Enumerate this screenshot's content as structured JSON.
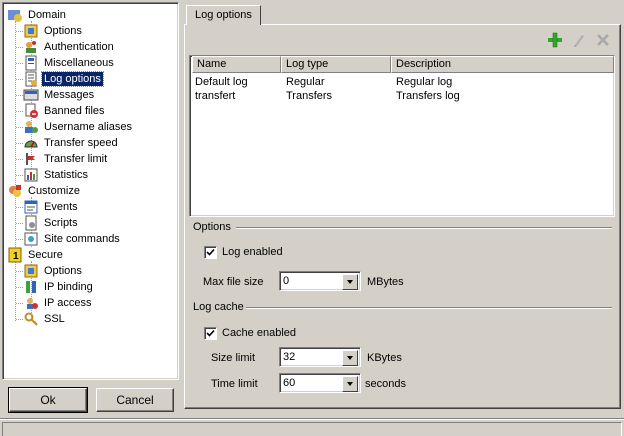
{
  "tree": {
    "items": [
      {
        "label": "Domain",
        "icon": "domain-icon"
      },
      {
        "label": "Options",
        "icon": "options-icon"
      },
      {
        "label": "Authentication",
        "icon": "authentication-icon"
      },
      {
        "label": "Miscellaneous",
        "icon": "miscellaneous-icon"
      },
      {
        "label": "Log options",
        "icon": "log-options-icon"
      },
      {
        "label": "Messages",
        "icon": "messages-icon"
      },
      {
        "label": "Banned files",
        "icon": "banned-files-icon"
      },
      {
        "label": "Username aliases",
        "icon": "username-aliases-icon"
      },
      {
        "label": "Transfer speed",
        "icon": "transfer-speed-icon"
      },
      {
        "label": "Transfer limit",
        "icon": "transfer-limit-icon"
      },
      {
        "label": "Statistics",
        "icon": "statistics-icon"
      },
      {
        "label": "Customize",
        "icon": "customize-icon"
      },
      {
        "label": "Events",
        "icon": "events-icon"
      },
      {
        "label": "Scripts",
        "icon": "scripts-icon"
      },
      {
        "label": "Site commands",
        "icon": "site-commands-icon"
      },
      {
        "label": "Secure",
        "icon": "secure-icon"
      },
      {
        "label": "Options",
        "icon": "options-icon"
      },
      {
        "label": "IP binding",
        "icon": "ip-binding-icon"
      },
      {
        "label": "IP access",
        "icon": "ip-access-icon"
      },
      {
        "label": "SSL",
        "icon": "ssl-key-icon"
      }
    ],
    "selected": "Log options"
  },
  "buttons": {
    "ok": "Ok",
    "cancel": "Cancel"
  },
  "tab": {
    "label": "Log options"
  },
  "toolbar": {
    "add_icon": "plus-icon",
    "edit_icon": "edit-icon",
    "delete_icon": "delete-icon",
    "add_color": "#2ea82e"
  },
  "log_list": {
    "columns": [
      "Name",
      "Log type",
      "Description"
    ],
    "rows": [
      [
        "Default log",
        "Regular",
        "Regular log"
      ],
      [
        "transfert",
        "Transfers",
        "Transfers log"
      ]
    ]
  },
  "options": {
    "title": "Options",
    "log_enabled_label": "Log enabled",
    "log_enabled": true,
    "max_file_size_label": "Max file size",
    "max_file_size_value": "0",
    "max_file_size_unit": "MBytes"
  },
  "log_cache": {
    "title": "Log cache",
    "cache_enabled_label": "Cache enabled",
    "cache_enabled": true,
    "size_limit_label": "Size limit",
    "size_limit_value": "32",
    "size_limit_unit": "KBytes",
    "time_limit_label": "Time limit",
    "time_limit_value": "60",
    "time_limit_unit": "seconds"
  },
  "colors": {
    "selection": "#0a246a",
    "face": "#d4d0c8"
  }
}
